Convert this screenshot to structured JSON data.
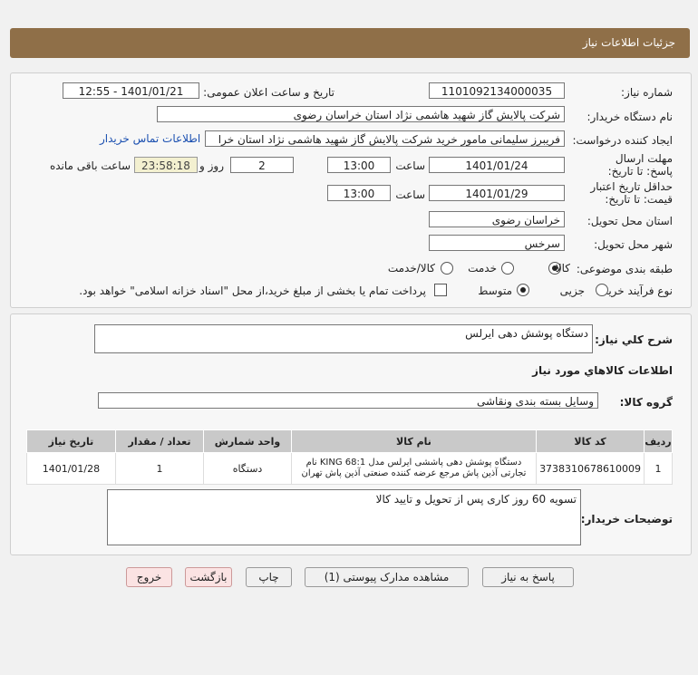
{
  "header": {
    "title": "جزئیات اطلاعات نیاز"
  },
  "form": {
    "need_number_label": "شماره نیاز:",
    "need_number": "1101092134000035",
    "announce_label": "تاریخ و ساعت اعلان عمومی:",
    "announce_value": "1401/01/21 - 12:55",
    "buyer_label": "نام دستگاه خریدار:",
    "buyer_value": "شرکت پالایش گاز شهید هاشمی نژاد   استان خراسان رضوی",
    "creator_label": "ایجاد کننده درخواست:",
    "creator_value": "فریبرز  سلیمانی مامور خرید شرکت پالایش گاز شهید هاشمی نژاد   استان خرا",
    "contact_link": "اطلاعات تماس خریدار",
    "deadline_label": "مهلت ارسال پاسخ: تا تاریخ:",
    "deadline_date": "1401/01/24",
    "time_label": "ساعت",
    "deadline_time": "13:00",
    "days_value": "2",
    "days_label": "روز و",
    "remaining_time": "23:58:18",
    "remaining_label": "ساعت باقی مانده",
    "validity_label": "حداقل تاریخ اعتبار قیمت: تا تاریخ:",
    "validity_date": "1401/01/29",
    "validity_time": "13:00",
    "province_label": "استان محل تحویل:",
    "province_value": "خراسان رضوی",
    "city_label": "شهر محل تحویل:",
    "city_value": "سرخس",
    "category_label": "طبقه بندی موضوعی:",
    "category_options": [
      "کالا",
      "خدمت",
      "کالا/خدمت"
    ],
    "category_selected": "کالا",
    "process_label": "نوع فرآیند خرید :",
    "process_options": [
      "جزیی",
      "متوسط"
    ],
    "process_selected": "متوسط",
    "treasury_note": "پرداخت تمام یا بخشی از مبلغ خرید،از محل \"اسناد خزانه اسلامی\" خواهد بود."
  },
  "details": {
    "summary_label": "شرح کلي نياز:",
    "summary_value": "دستگاه پوشش دهی ایرلس",
    "goods_info_title": "اطلاعات کالاهاي مورد نياز",
    "group_label": "گروه کالا:",
    "group_value": "وسایل بسته بندی  ونقاشی",
    "table": {
      "headers": [
        "ردیف",
        "کد کالا",
        "نام کالا",
        "واحد شمارش",
        "تعداد / مقدار",
        "تاریخ نیاز"
      ],
      "rows": [
        {
          "row": "1",
          "code": "3738310678610009",
          "name_line1": "دستگاه پوشش دهی پاششی ایرلس مدل KING 68:1 نام",
          "name_line2": "تجارتی آذین پاش مرجع عرضه کننده صنعتی آذین پاش تهران",
          "unit": "دستگاه",
          "qty": "1",
          "date": "1401/01/28"
        }
      ]
    },
    "buyer_notes_label": "توضیحات خریدار:",
    "buyer_notes_value": "تسویه 60 روز کاری پس از تحویل و تایید کالا"
  },
  "buttons": {
    "reply": "پاسخ به نیاز",
    "attachments": "مشاهده مدارک پیوستی (1)",
    "print": "چاپ",
    "back": "بازگشت",
    "exit": "خروج"
  }
}
